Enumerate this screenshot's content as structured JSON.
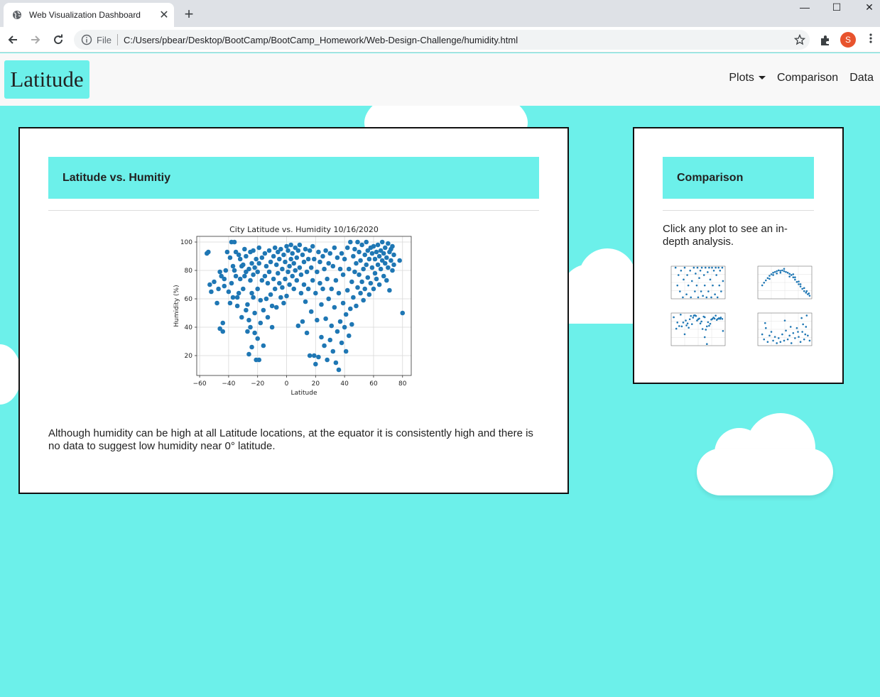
{
  "browser": {
    "tab_title": "Web Visualization Dashboard",
    "new_tab": "+",
    "close_tab": "✕",
    "file_label": "File",
    "url": "C:/Users/pbear/Desktop/BootCamp/BootCamp_Homework/Web-Design-Challenge/humidity.html",
    "profile_initial": "S",
    "minimize": "—",
    "maximize": "☐",
    "close_window": "✕"
  },
  "navbar": {
    "brand": "Latitude",
    "links": [
      "Plots",
      "Comparison",
      "Data"
    ]
  },
  "main": {
    "heading": "Latitude vs. Humitiy",
    "description": "Although humidity can be high at all Latitude locations, at the equator it is consistently high and there is no data to suggest low humidity near 0° latitude."
  },
  "sidebar": {
    "heading": "Comparison",
    "text": "Click any plot to see an in-depth analysis.",
    "thumbnails": [
      "Latitude vs. Cloudiness",
      "Latitude vs. Temperature",
      "Latitude vs. Humidity",
      "Latitude vs. Wind Speed"
    ]
  },
  "chart_data": {
    "type": "scatter",
    "title": "City Latitude vs. Humidity 10/16/2020",
    "xlabel": "Latitude",
    "ylabel": "Humidity (%)",
    "xlim": [
      -62,
      86
    ],
    "ylim": [
      6,
      104
    ],
    "xticks": [
      -60,
      -40,
      -20,
      0,
      20,
      40,
      60,
      80
    ],
    "yticks": [
      20,
      40,
      60,
      80,
      100
    ],
    "grid": true,
    "color": "#1f77b4",
    "points": [
      [
        -55,
        92
      ],
      [
        -54,
        93
      ],
      [
        -53,
        70
      ],
      [
        -52,
        65
      ],
      [
        -50,
        72
      ],
      [
        -48,
        57
      ],
      [
        -47,
        67
      ],
      [
        -46,
        39
      ],
      [
        -46,
        79
      ],
      [
        -45,
        76
      ],
      [
        -44,
        43
      ],
      [
        -44,
        37
      ],
      [
        -43,
        69
      ],
      [
        -43,
        74
      ],
      [
        -42,
        80
      ],
      [
        -41,
        93
      ],
      [
        -40,
        65
      ],
      [
        -39,
        89
      ],
      [
        -39,
        57
      ],
      [
        -38,
        100
      ],
      [
        -38,
        71
      ],
      [
        -37,
        61
      ],
      [
        -37,
        83
      ],
      [
        -36,
        100
      ],
      [
        -36,
        80
      ],
      [
        -35,
        93
      ],
      [
        -35,
        76
      ],
      [
        -34,
        55
      ],
      [
        -34,
        61
      ],
      [
        -33,
        64
      ],
      [
        -33,
        91
      ],
      [
        -32,
        88
      ],
      [
        -32,
        74
      ],
      [
        -31,
        83
      ],
      [
        -31,
        47
      ],
      [
        -30,
        67
      ],
      [
        -30,
        84
      ],
      [
        -29,
        76
      ],
      [
        -29,
        95
      ],
      [
        -28,
        79
      ],
      [
        -28,
        52
      ],
      [
        -28,
        90
      ],
      [
        -27,
        37
      ],
      [
        -27,
        56
      ],
      [
        -26,
        45
      ],
      [
        -26,
        81
      ],
      [
        -26,
        21
      ],
      [
        -25,
        73
      ],
      [
        -25,
        40
      ],
      [
        -25,
        93
      ],
      [
        -24,
        64
      ],
      [
        -24,
        85
      ],
      [
        -24,
        26
      ],
      [
        -23,
        77
      ],
      [
        -23,
        61
      ],
      [
        -23,
        94
      ],
      [
        -22,
        82
      ],
      [
        -22,
        36
      ],
      [
        -22,
        50
      ],
      [
        -21,
        88
      ],
      [
        -21,
        17
      ],
      [
        -20,
        67
      ],
      [
        -20,
        79
      ],
      [
        -20,
        32
      ],
      [
        -19,
        17
      ],
      [
        -19,
        96
      ],
      [
        -19,
        85
      ],
      [
        -18,
        43
      ],
      [
        -18,
        59
      ],
      [
        -17,
        73
      ],
      [
        -17,
        89
      ],
      [
        -16,
        52
      ],
      [
        -16,
        27
      ],
      [
        -15,
        76
      ],
      [
        -15,
        92
      ],
      [
        -14,
        60
      ],
      [
        -14,
        83
      ],
      [
        -13,
        47
      ],
      [
        -13,
        71
      ],
      [
        -12,
        94
      ],
      [
        -12,
        79
      ],
      [
        -11,
        63
      ],
      [
        -11,
        86
      ],
      [
        -10,
        40
      ],
      [
        -10,
        55
      ],
      [
        -9,
        90
      ],
      [
        -9,
        74
      ],
      [
        -8,
        96
      ],
      [
        -8,
        67
      ],
      [
        -7,
        84
      ],
      [
        -7,
        54
      ],
      [
        -6,
        78
      ],
      [
        -6,
        93
      ],
      [
        -5,
        71
      ],
      [
        -5,
        88
      ],
      [
        -4,
        61
      ],
      [
        -4,
        95
      ],
      [
        -3,
        81
      ],
      [
        -3,
        68
      ],
      [
        -2,
        91
      ],
      [
        -2,
        57
      ],
      [
        -1,
        86
      ],
      [
        -1,
        74
      ],
      [
        0,
        97
      ],
      [
        0,
        62
      ],
      [
        1,
        79
      ],
      [
        1,
        94
      ],
      [
        2,
        83
      ],
      [
        2,
        70
      ],
      [
        3,
        98
      ],
      [
        3,
        88
      ],
      [
        4,
        76
      ],
      [
        4,
        92
      ],
      [
        5,
        85
      ],
      [
        5,
        67
      ],
      [
        6,
        96
      ],
      [
        6,
        80
      ],
      [
        7,
        89
      ],
      [
        7,
        73
      ],
      [
        8,
        94
      ],
      [
        8,
        41
      ],
      [
        9,
        82
      ],
      [
        9,
        98
      ],
      [
        10,
        77
      ],
      [
        10,
        64
      ],
      [
        11,
        91
      ],
      [
        11,
        44
      ],
      [
        12,
        86
      ],
      [
        12,
        70
      ],
      [
        13,
        95
      ],
      [
        13,
        58
      ],
      [
        14,
        79
      ],
      [
        14,
        36
      ],
      [
        15,
        88
      ],
      [
        15,
        67
      ],
      [
        16,
        94
      ],
      [
        16,
        20
      ],
      [
        17,
        82
      ],
      [
        17,
        51
      ],
      [
        18,
        73
      ],
      [
        18,
        97
      ],
      [
        19,
        20
      ],
      [
        19,
        88
      ],
      [
        20,
        64
      ],
      [
        20,
        14
      ],
      [
        21,
        79
      ],
      [
        21,
        45
      ],
      [
        22,
        93
      ],
      [
        22,
        19
      ],
      [
        23,
        71
      ],
      [
        23,
        86
      ],
      [
        24,
        33
      ],
      [
        24,
        56
      ],
      [
        25,
        90
      ],
      [
        25,
        67
      ],
      [
        26,
        27
      ],
      [
        26,
        81
      ],
      [
        27,
        94
      ],
      [
        27,
        46
      ],
      [
        28,
        74
      ],
      [
        28,
        17
      ],
      [
        29,
        85
      ],
      [
        29,
        60
      ],
      [
        30,
        31
      ],
      [
        30,
        92
      ],
      [
        31,
        67
      ],
      [
        31,
        41
      ],
      [
        32,
        83
      ],
      [
        32,
        23
      ],
      [
        33,
        96
      ],
      [
        33,
        54
      ],
      [
        34,
        73
      ],
      [
        34,
        15
      ],
      [
        35,
        89
      ],
      [
        35,
        37
      ],
      [
        36,
        64
      ],
      [
        36,
        10
      ],
      [
        37,
        81
      ],
      [
        37,
        44
      ],
      [
        38,
        92
      ],
      [
        38,
        29
      ],
      [
        39,
        57
      ],
      [
        39,
        77
      ],
      [
        40,
        40
      ],
      [
        40,
        88
      ],
      [
        41,
        49
      ],
      [
        41,
        23
      ],
      [
        42,
        66
      ],
      [
        42,
        96
      ],
      [
        43,
        34
      ],
      [
        43,
        81
      ],
      [
        44,
        53
      ],
      [
        44,
        100
      ],
      [
        45,
        42
      ],
      [
        45,
        72
      ],
      [
        46,
        90
      ],
      [
        46,
        61
      ],
      [
        47,
        79
      ],
      [
        47,
        95
      ],
      [
        48,
        55
      ],
      [
        48,
        85
      ],
      [
        49,
        68
      ],
      [
        49,
        100
      ],
      [
        50,
        93
      ],
      [
        50,
        77
      ],
      [
        51,
        64
      ],
      [
        51,
        87
      ],
      [
        52,
        98
      ],
      [
        52,
        72
      ],
      [
        53,
        81
      ],
      [
        53,
        59
      ],
      [
        54,
        91
      ],
      [
        54,
        67
      ],
      [
        55,
        100
      ],
      [
        55,
        84
      ],
      [
        56,
        75
      ],
      [
        56,
        94
      ],
      [
        57,
        63
      ],
      [
        57,
        88
      ],
      [
        58,
        96
      ],
      [
        58,
        71
      ],
      [
        59,
        82
      ],
      [
        59,
        92
      ],
      [
        60,
        67
      ],
      [
        60,
        97
      ],
      [
        61,
        78
      ],
      [
        61,
        88
      ],
      [
        62,
        93
      ],
      [
        62,
        74
      ],
      [
        63,
        84
      ],
      [
        63,
        98
      ],
      [
        64,
        70
      ],
      [
        64,
        90
      ],
      [
        65,
        94
      ],
      [
        65,
        81
      ],
      [
        66,
        87
      ],
      [
        66,
        100
      ],
      [
        67,
        76
      ],
      [
        67,
        92
      ],
      [
        68,
        96
      ],
      [
        68,
        85
      ],
      [
        69,
        89
      ],
      [
        69,
        73
      ],
      [
        70,
        99
      ],
      [
        70,
        82
      ],
      [
        71,
        93
      ],
      [
        71,
        66
      ],
      [
        72,
        87
      ],
      [
        72,
        95
      ],
      [
        73,
        80
      ],
      [
        73,
        97
      ],
      [
        74,
        91
      ],
      [
        74,
        84
      ],
      [
        78,
        87
      ],
      [
        80,
        50
      ]
    ]
  },
  "thumbnail_data": {
    "cloudiness": [
      [
        -50,
        100
      ],
      [
        -45,
        40
      ],
      [
        -42,
        75
      ],
      [
        -38,
        20
      ],
      [
        -35,
        90
      ],
      [
        -30,
        0
      ],
      [
        -28,
        60
      ],
      [
        -25,
        100
      ],
      [
        -20,
        10
      ],
      [
        -18,
        75
      ],
      [
        -15,
        40
      ],
      [
        -10,
        90
      ],
      [
        -8,
        0
      ],
      [
        -5,
        55
      ],
      [
        0,
        100
      ],
      [
        3,
        20
      ],
      [
        5,
        80
      ],
      [
        8,
        40
      ],
      [
        10,
        100
      ],
      [
        12,
        0
      ],
      [
        15,
        65
      ],
      [
        18,
        90
      ],
      [
        20,
        20
      ],
      [
        22,
        100
      ],
      [
        25,
        5
      ],
      [
        28,
        75
      ],
      [
        30,
        40
      ],
      [
        32,
        100
      ],
      [
        35,
        0
      ],
      [
        38,
        85
      ],
      [
        40,
        20
      ],
      [
        42,
        100
      ],
      [
        45,
        60
      ],
      [
        48,
        0
      ],
      [
        50,
        100
      ],
      [
        52,
        40
      ],
      [
        55,
        90
      ],
      [
        58,
        10
      ],
      [
        60,
        100
      ],
      [
        62,
        75
      ],
      [
        65,
        0
      ],
      [
        68,
        100
      ],
      [
        70,
        40
      ],
      [
        72,
        90
      ],
      [
        75,
        20
      ],
      [
        78,
        100
      ],
      [
        80,
        55
      ]
    ],
    "temperature": [
      [
        -50,
        45
      ],
      [
        -45,
        52
      ],
      [
        -40,
        58
      ],
      [
        -35,
        64
      ],
      [
        -30,
        70
      ],
      [
        -25,
        74
      ],
      [
        -20,
        78
      ],
      [
        -15,
        80
      ],
      [
        -10,
        82
      ],
      [
        -5,
        84
      ],
      [
        0,
        83
      ],
      [
        5,
        84
      ],
      [
        10,
        82
      ],
      [
        15,
        80
      ],
      [
        20,
        78
      ],
      [
        25,
        75
      ],
      [
        30,
        72
      ],
      [
        35,
        66
      ],
      [
        40,
        60
      ],
      [
        45,
        54
      ],
      [
        50,
        48
      ],
      [
        55,
        42
      ],
      [
        60,
        36
      ],
      [
        65,
        30
      ],
      [
        70,
        26
      ],
      [
        75,
        22
      ],
      [
        80,
        18
      ],
      [
        -30,
        62
      ],
      [
        -10,
        76
      ],
      [
        10,
        88
      ],
      [
        25,
        68
      ],
      [
        40,
        66
      ],
      [
        55,
        48
      ],
      [
        65,
        38
      ],
      [
        72,
        30
      ],
      [
        78,
        24
      ],
      [
        50,
        55
      ],
      [
        -20,
        72
      ],
      [
        0,
        78
      ],
      [
        35,
        74
      ]
    ],
    "humidity": [
      [
        -55,
        92
      ],
      [
        -48,
        57
      ],
      [
        -45,
        76
      ],
      [
        -40,
        65
      ],
      [
        -36,
        100
      ],
      [
        -33,
        64
      ],
      [
        -29,
        76
      ],
      [
        -25,
        40
      ],
      [
        -22,
        82
      ],
      [
        -20,
        67
      ],
      [
        -17,
        73
      ],
      [
        -14,
        60
      ],
      [
        -11,
        86
      ],
      [
        -8,
        96
      ],
      [
        -5,
        71
      ],
      [
        -2,
        91
      ],
      [
        0,
        97
      ],
      [
        3,
        98
      ],
      [
        6,
        96
      ],
      [
        9,
        82
      ],
      [
        12,
        86
      ],
      [
        15,
        88
      ],
      [
        18,
        73
      ],
      [
        21,
        79
      ],
      [
        24,
        56
      ],
      [
        27,
        94
      ],
      [
        30,
        92
      ],
      [
        33,
        54
      ],
      [
        36,
        64
      ],
      [
        39,
        77
      ],
      [
        42,
        66
      ],
      [
        45,
        72
      ],
      [
        48,
        85
      ],
      [
        51,
        87
      ],
      [
        54,
        91
      ],
      [
        57,
        88
      ],
      [
        60,
        97
      ],
      [
        63,
        84
      ],
      [
        66,
        87
      ],
      [
        69,
        89
      ],
      [
        72,
        87
      ],
      [
        74,
        91
      ],
      [
        78,
        87
      ],
      [
        80,
        50
      ],
      [
        36,
        10
      ],
      [
        30,
        31
      ]
    ],
    "wind": [
      [
        -50,
        9
      ],
      [
        -45,
        5
      ],
      [
        -40,
        14
      ],
      [
        -35,
        3
      ],
      [
        -30,
        8
      ],
      [
        -25,
        11
      ],
      [
        -20,
        4
      ],
      [
        -15,
        7
      ],
      [
        -10,
        2
      ],
      [
        -5,
        6
      ],
      [
        0,
        3
      ],
      [
        5,
        9
      ],
      [
        10,
        4
      ],
      [
        15,
        12
      ],
      [
        20,
        5
      ],
      [
        25,
        8
      ],
      [
        30,
        2
      ],
      [
        35,
        10
      ],
      [
        40,
        6
      ],
      [
        45,
        14
      ],
      [
        50,
        7
      ],
      [
        55,
        3
      ],
      [
        60,
        11
      ],
      [
        65,
        5
      ],
      [
        70,
        15
      ],
      [
        75,
        8
      ],
      [
        80,
        4
      ],
      [
        -42,
        18
      ],
      [
        12,
        20
      ],
      [
        58,
        22
      ],
      [
        62,
        17
      ],
      [
        28,
        15
      ],
      [
        48,
        11
      ],
      [
        68,
        9
      ],
      [
        72,
        24
      ]
    ]
  }
}
